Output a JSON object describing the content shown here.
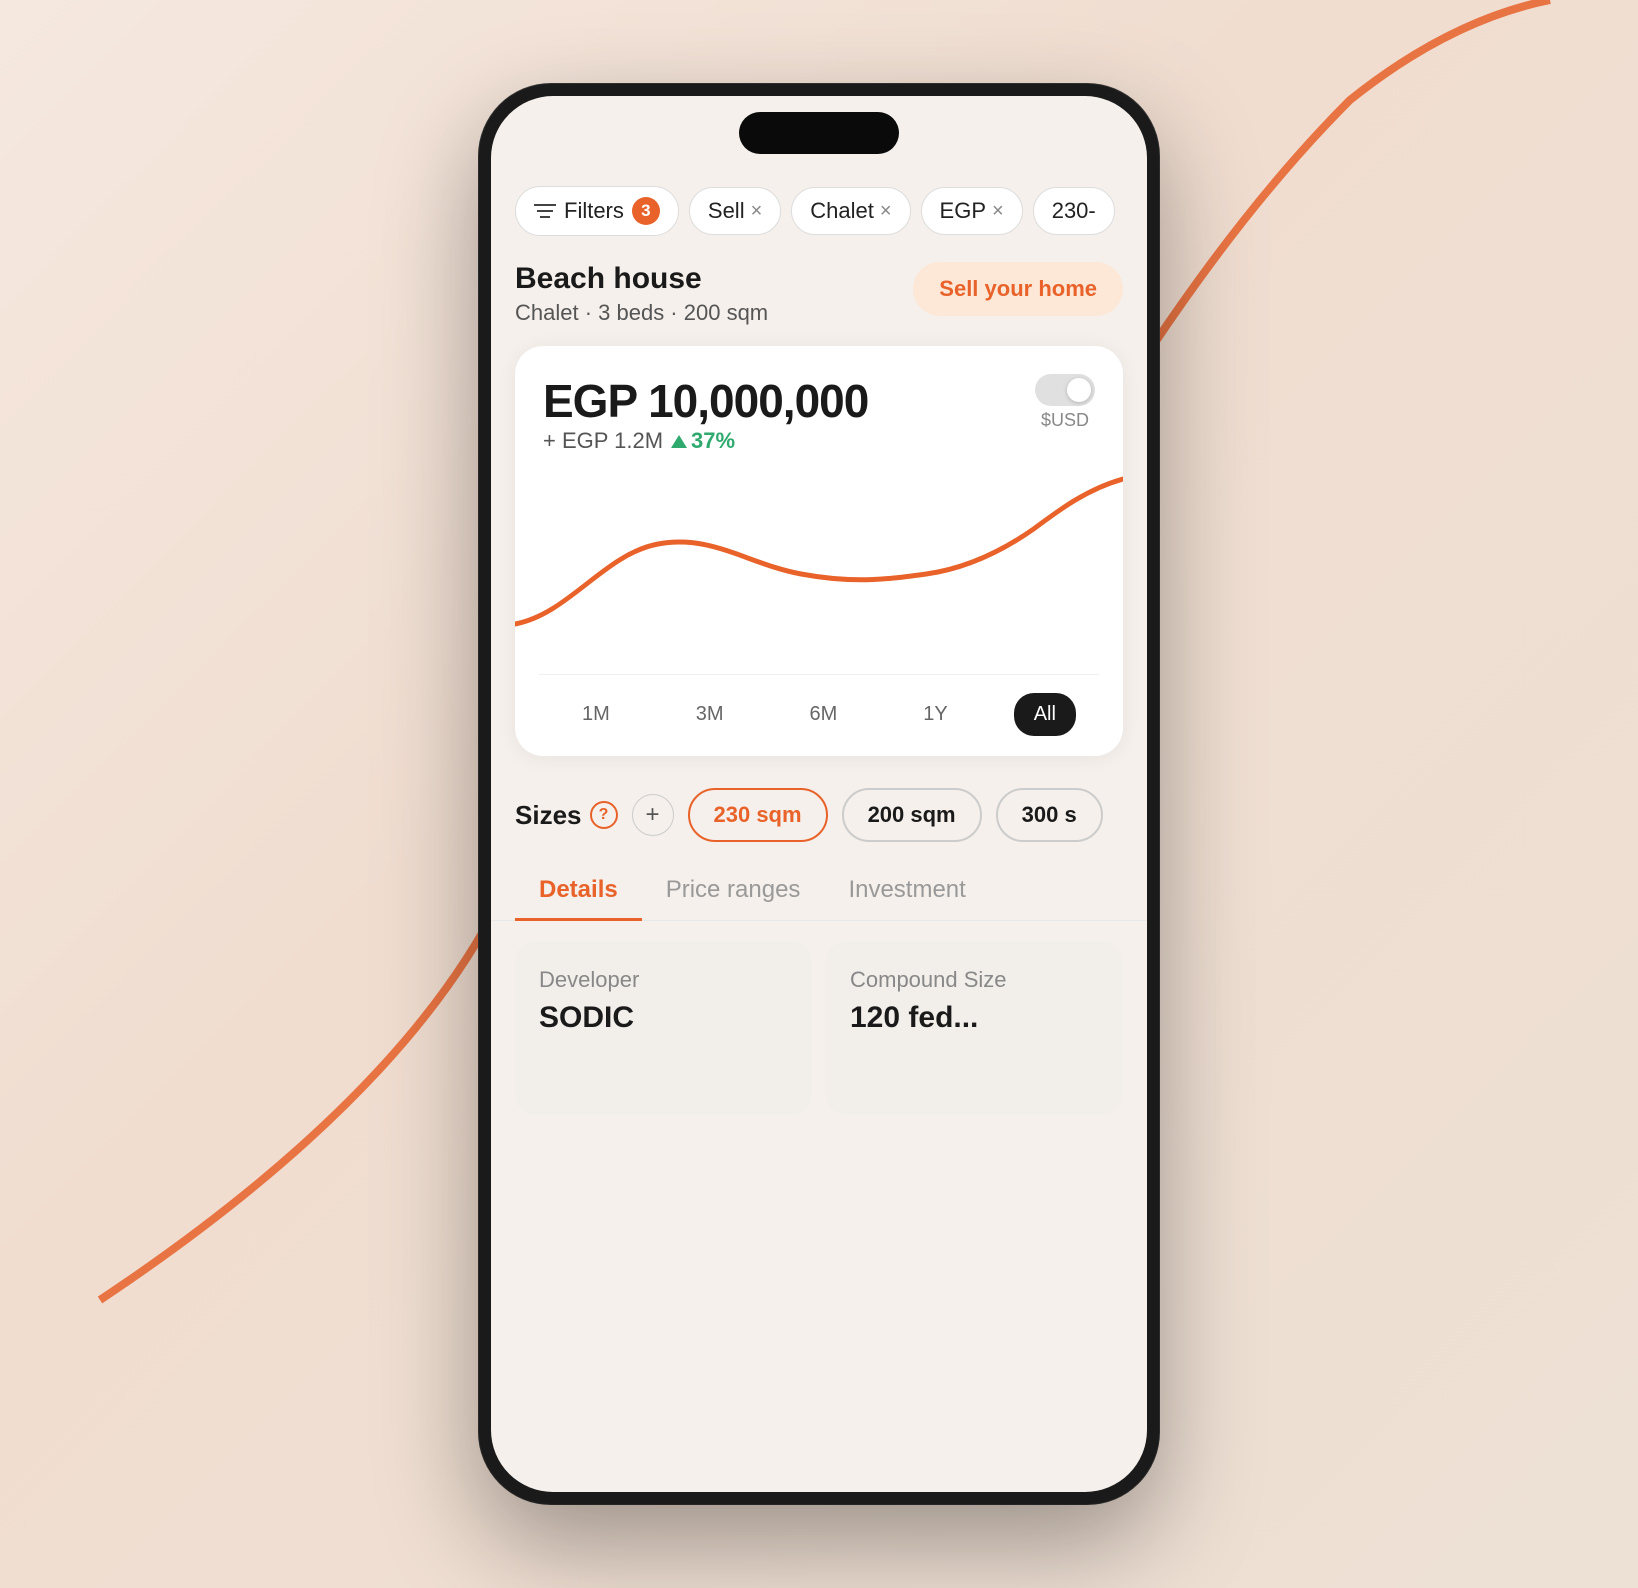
{
  "background": {
    "color": "#f5e8df"
  },
  "phone": {
    "filters": {
      "label": "Filters",
      "badge": "3",
      "chips": [
        {
          "id": "sell",
          "label": "Sell",
          "closable": true
        },
        {
          "id": "chalet",
          "label": "Chalet",
          "closable": true
        },
        {
          "id": "egp",
          "label": "EGP",
          "closable": true
        },
        {
          "id": "230",
          "label": "230-",
          "closable": false
        }
      ]
    },
    "property": {
      "title": "Beach house",
      "subtitle": "Chalet · 3 beds · 200 sqm",
      "sell_button": "Sell your home"
    },
    "price_card": {
      "price": "EGP 10,000,000",
      "change": "+ EGP 1.2M",
      "change_pct": "37%",
      "usd_label": "$USD",
      "time_ranges": [
        {
          "label": "1M",
          "active": false
        },
        {
          "label": "3M",
          "active": false
        },
        {
          "label": "6M",
          "active": false
        },
        {
          "label": "1Y",
          "active": false
        },
        {
          "label": "All",
          "active": true
        }
      ]
    },
    "sizes": {
      "label": "Sizes",
      "chips": [
        {
          "label": "230 sqm",
          "active": true
        },
        {
          "label": "200 sqm",
          "active": false
        },
        {
          "label": "300 s",
          "active": false,
          "partial": true
        }
      ]
    },
    "tabs": [
      {
        "label": "Details",
        "active": true
      },
      {
        "label": "Price ranges",
        "active": false
      },
      {
        "label": "Investment",
        "active": false
      }
    ],
    "detail_cards": [
      {
        "title": "Developer",
        "value": "SODIC"
      },
      {
        "title": "Compound Size",
        "value": "120 fe..."
      }
    ]
  }
}
